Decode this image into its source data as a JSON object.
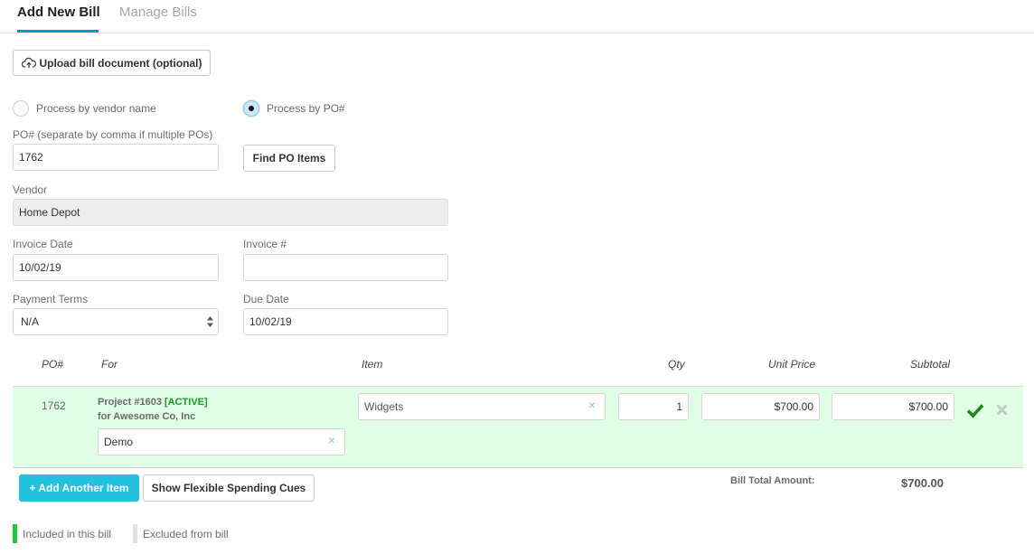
{
  "tabs": [
    {
      "label": "Add New Bill",
      "active": true
    },
    {
      "label": "Manage Bills",
      "active": false
    }
  ],
  "upload": {
    "label": "Upload bill document (optional)",
    "icon": "cloud-upload-icon"
  },
  "process_mode": {
    "options": [
      {
        "label": "Process by vendor name",
        "checked": false
      },
      {
        "label": "Process by PO#",
        "checked": true
      }
    ]
  },
  "po": {
    "label": "PO# (separate by comma if multiple POs)",
    "value": "1762",
    "find_button": "Find PO Items"
  },
  "vendor": {
    "label": "Vendor",
    "value": "Home Depot"
  },
  "invoice_date": {
    "label": "Invoice Date",
    "value": "10/02/19"
  },
  "invoice_number": {
    "label": "Invoice #",
    "value": ""
  },
  "payment_terms": {
    "label": "Payment Terms",
    "value": "N/A"
  },
  "due_date": {
    "label": "Due Date",
    "value": "10/02/19"
  },
  "table": {
    "headers": {
      "po": "PO#",
      "for": "For",
      "item": "Item",
      "qty": "Qty",
      "unit_price": "Unit Price",
      "subtotal": "Subtotal"
    },
    "rows": [
      {
        "po": "1762",
        "project": "Project #1603",
        "status": "[ACTIVE]",
        "client": "for Awesome Co, Inc",
        "for_value": "Demo",
        "item": "Widgets",
        "qty": "1",
        "unit_price": "$700.00",
        "subtotal": "$700.00",
        "included": true
      }
    ]
  },
  "actions": {
    "add_item": "+ Add Another Item",
    "show_cues": "Show Flexible Spending Cues"
  },
  "total": {
    "label": "Bill Total Amount:",
    "value": "$700.00"
  },
  "legend": [
    {
      "label": "Included in this bill",
      "color": "#1ec93b"
    },
    {
      "label": "Excluded from bill",
      "color": "#e2e2e2"
    }
  ],
  "colors": {
    "accent": "#0e97cc",
    "add_button": "#22c1e0",
    "included_row": "#e0fde5",
    "check": "#1a8a1a"
  }
}
